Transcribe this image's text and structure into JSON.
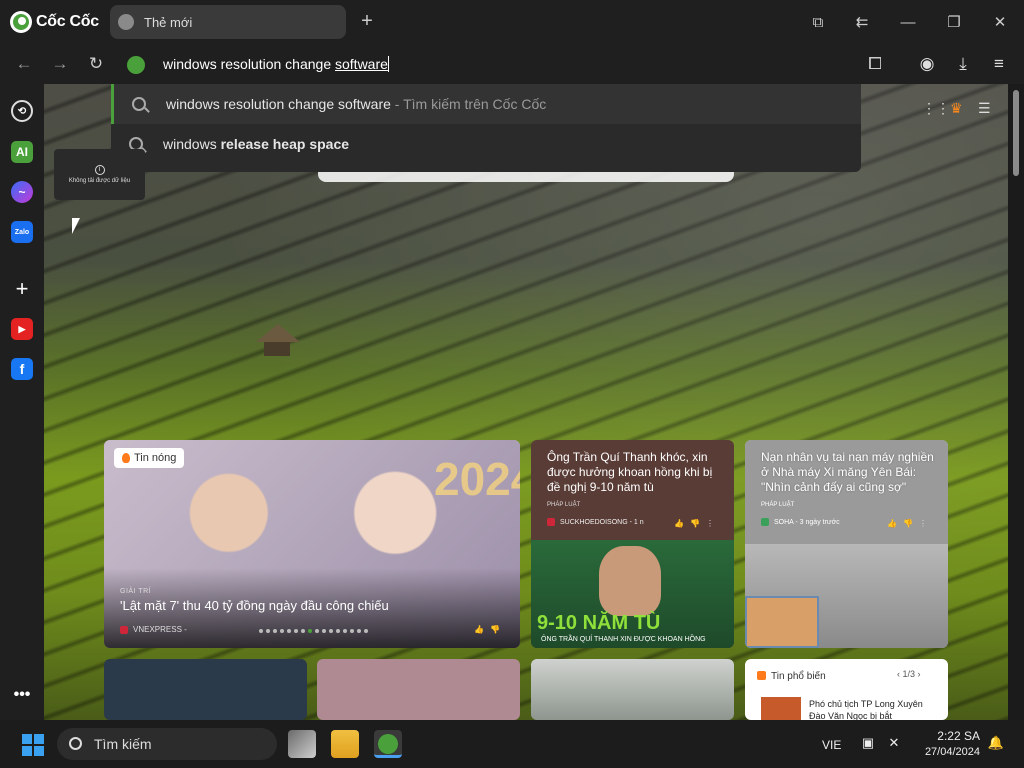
{
  "browser": {
    "brand": "Cốc Cốc",
    "tab_label": "Thẻ mới"
  },
  "omnibox": {
    "typed": "windows resolution change ",
    "completion": "software"
  },
  "suggestions": [
    {
      "query": "windows resolution change software",
      "hint": " - Tìm kiếm trên Cốc Cốc"
    },
    {
      "prefix": "windows ",
      "bold": "release heap space"
    }
  ],
  "tooltip_text": "Không tải được dữ liệu",
  "news": {
    "big": {
      "badge": "Tin nóng",
      "year_text": "2024",
      "category": "GIẢI TRÍ",
      "title": "'Lật mặt 7' thu 40 tỷ đồng ngày đầu công chiếu",
      "source": "VNEXPRESS -"
    },
    "mid": {
      "title": "Ông Trần Quí Thanh khóc, xin được hưởng khoan hồng khi bị đề nghị 9-10 năm tù",
      "category": "PHÁP LUẬT",
      "source": "SUCKHOEDOISONG - 1 n",
      "image_text": "9-10 NĂM TÙ",
      "image_caption": "ÔNG TRẦN QUÍ THANH XIN ĐƯỢC KHOAN HỒNG"
    },
    "right": {
      "title": "Nạn nhân vụ tai nạn máy nghiền ở Nhà máy Xi măng Yên Bái: \"Nhìn cảnh đấy ai cũng sợ\"",
      "category": "PHÁP LUẬT",
      "source": "SOHA - 3 ngày trước"
    },
    "trending": {
      "title": "Tin phổ biến",
      "page": "1/3",
      "item": "Phó chủ tịch TP Long Xuyên Đào Văn Ngọc bị bắt"
    }
  },
  "taskbar": {
    "search_label": "Tìm kiếm",
    "language": "VIE",
    "time": "2:22 SA",
    "date": "27/04/2024"
  }
}
